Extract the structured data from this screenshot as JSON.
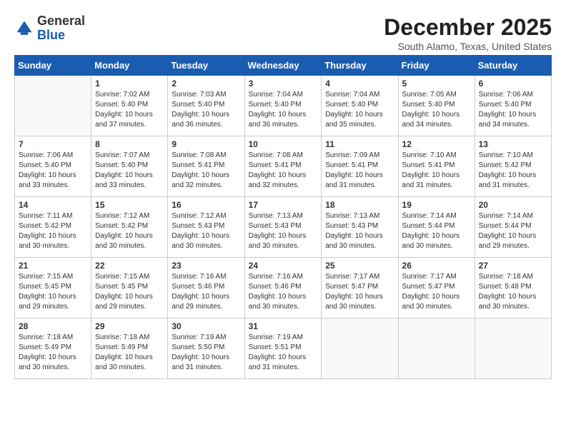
{
  "app": {
    "name": "GeneralBlue",
    "logo_general": "General",
    "logo_blue": "Blue"
  },
  "header": {
    "title": "December 2025",
    "subtitle": "South Alamo, Texas, United States"
  },
  "days_of_week": [
    "Sunday",
    "Monday",
    "Tuesday",
    "Wednesday",
    "Thursday",
    "Friday",
    "Saturday"
  ],
  "weeks": [
    [
      {
        "day": "",
        "info": ""
      },
      {
        "day": "1",
        "info": "Sunrise: 7:02 AM\nSunset: 5:40 PM\nDaylight: 10 hours\nand 37 minutes."
      },
      {
        "day": "2",
        "info": "Sunrise: 7:03 AM\nSunset: 5:40 PM\nDaylight: 10 hours\nand 36 minutes."
      },
      {
        "day": "3",
        "info": "Sunrise: 7:04 AM\nSunset: 5:40 PM\nDaylight: 10 hours\nand 36 minutes."
      },
      {
        "day": "4",
        "info": "Sunrise: 7:04 AM\nSunset: 5:40 PM\nDaylight: 10 hours\nand 35 minutes."
      },
      {
        "day": "5",
        "info": "Sunrise: 7:05 AM\nSunset: 5:40 PM\nDaylight: 10 hours\nand 34 minutes."
      },
      {
        "day": "6",
        "info": "Sunrise: 7:06 AM\nSunset: 5:40 PM\nDaylight: 10 hours\nand 34 minutes."
      }
    ],
    [
      {
        "day": "7",
        "info": "Sunrise: 7:06 AM\nSunset: 5:40 PM\nDaylight: 10 hours\nand 33 minutes."
      },
      {
        "day": "8",
        "info": "Sunrise: 7:07 AM\nSunset: 5:40 PM\nDaylight: 10 hours\nand 33 minutes."
      },
      {
        "day": "9",
        "info": "Sunrise: 7:08 AM\nSunset: 5:41 PM\nDaylight: 10 hours\nand 32 minutes."
      },
      {
        "day": "10",
        "info": "Sunrise: 7:08 AM\nSunset: 5:41 PM\nDaylight: 10 hours\nand 32 minutes."
      },
      {
        "day": "11",
        "info": "Sunrise: 7:09 AM\nSunset: 5:41 PM\nDaylight: 10 hours\nand 31 minutes."
      },
      {
        "day": "12",
        "info": "Sunrise: 7:10 AM\nSunset: 5:41 PM\nDaylight: 10 hours\nand 31 minutes."
      },
      {
        "day": "13",
        "info": "Sunrise: 7:10 AM\nSunset: 5:42 PM\nDaylight: 10 hours\nand 31 minutes."
      }
    ],
    [
      {
        "day": "14",
        "info": "Sunrise: 7:11 AM\nSunset: 5:42 PM\nDaylight: 10 hours\nand 30 minutes."
      },
      {
        "day": "15",
        "info": "Sunrise: 7:12 AM\nSunset: 5:42 PM\nDaylight: 10 hours\nand 30 minutes."
      },
      {
        "day": "16",
        "info": "Sunrise: 7:12 AM\nSunset: 5:43 PM\nDaylight: 10 hours\nand 30 minutes."
      },
      {
        "day": "17",
        "info": "Sunrise: 7:13 AM\nSunset: 5:43 PM\nDaylight: 10 hours\nand 30 minutes."
      },
      {
        "day": "18",
        "info": "Sunrise: 7:13 AM\nSunset: 5:43 PM\nDaylight: 10 hours\nand 30 minutes."
      },
      {
        "day": "19",
        "info": "Sunrise: 7:14 AM\nSunset: 5:44 PM\nDaylight: 10 hours\nand 30 minutes."
      },
      {
        "day": "20",
        "info": "Sunrise: 7:14 AM\nSunset: 5:44 PM\nDaylight: 10 hours\nand 29 minutes."
      }
    ],
    [
      {
        "day": "21",
        "info": "Sunrise: 7:15 AM\nSunset: 5:45 PM\nDaylight: 10 hours\nand 29 minutes."
      },
      {
        "day": "22",
        "info": "Sunrise: 7:15 AM\nSunset: 5:45 PM\nDaylight: 10 hours\nand 29 minutes."
      },
      {
        "day": "23",
        "info": "Sunrise: 7:16 AM\nSunset: 5:46 PM\nDaylight: 10 hours\nand 29 minutes."
      },
      {
        "day": "24",
        "info": "Sunrise: 7:16 AM\nSunset: 5:46 PM\nDaylight: 10 hours\nand 30 minutes."
      },
      {
        "day": "25",
        "info": "Sunrise: 7:17 AM\nSunset: 5:47 PM\nDaylight: 10 hours\nand 30 minutes."
      },
      {
        "day": "26",
        "info": "Sunrise: 7:17 AM\nSunset: 5:47 PM\nDaylight: 10 hours\nand 30 minutes."
      },
      {
        "day": "27",
        "info": "Sunrise: 7:18 AM\nSunset: 5:48 PM\nDaylight: 10 hours\nand 30 minutes."
      }
    ],
    [
      {
        "day": "28",
        "info": "Sunrise: 7:18 AM\nSunset: 5:49 PM\nDaylight: 10 hours\nand 30 minutes."
      },
      {
        "day": "29",
        "info": "Sunrise: 7:18 AM\nSunset: 5:49 PM\nDaylight: 10 hours\nand 30 minutes."
      },
      {
        "day": "30",
        "info": "Sunrise: 7:19 AM\nSunset: 5:50 PM\nDaylight: 10 hours\nand 31 minutes."
      },
      {
        "day": "31",
        "info": "Sunrise: 7:19 AM\nSunset: 5:51 PM\nDaylight: 10 hours\nand 31 minutes."
      },
      {
        "day": "",
        "info": ""
      },
      {
        "day": "",
        "info": ""
      },
      {
        "day": "",
        "info": ""
      }
    ]
  ]
}
